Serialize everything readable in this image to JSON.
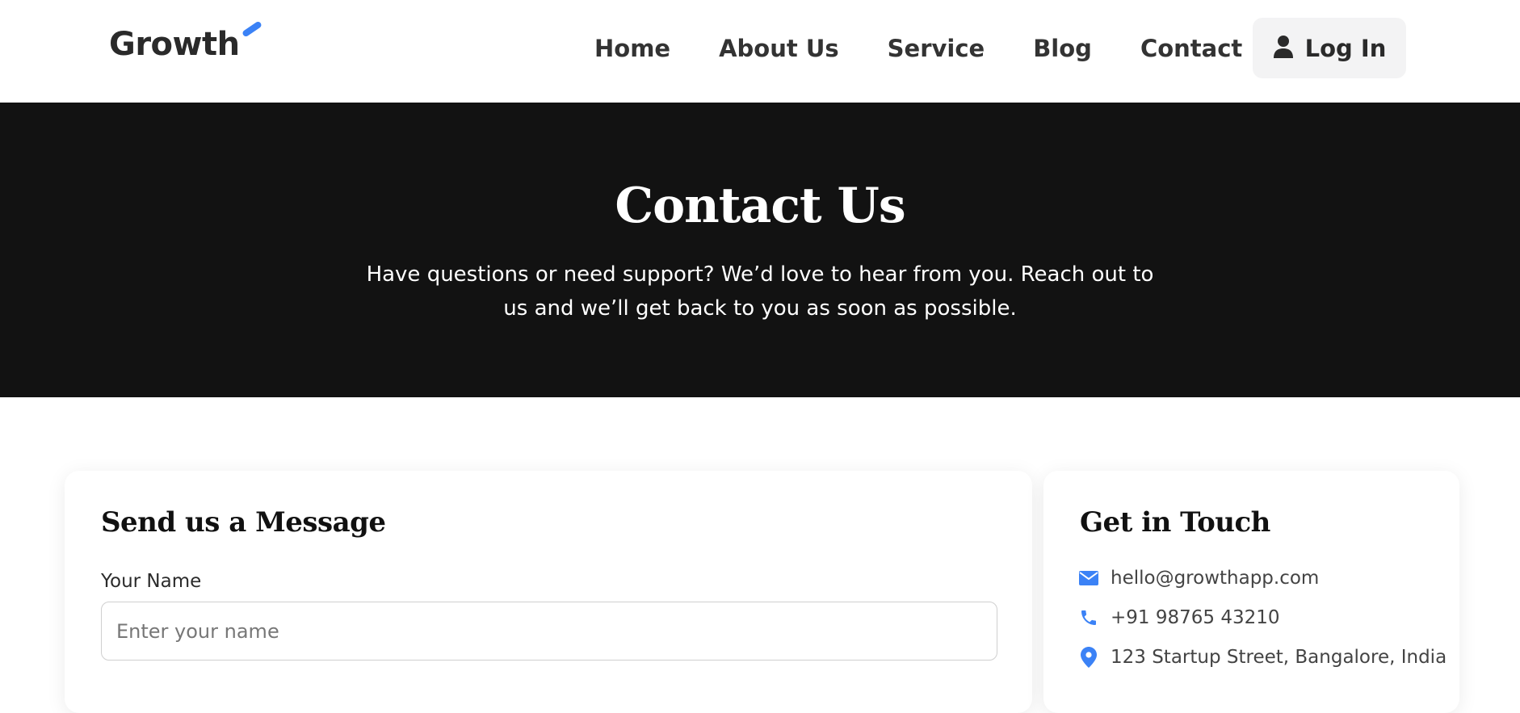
{
  "header": {
    "logo_text": "Growth",
    "nav": [
      "Home",
      "About Us",
      "Service",
      "Blog",
      "Contact"
    ],
    "login_label": "Log In",
    "login_icon": "user-icon"
  },
  "hero": {
    "title": "Contact Us",
    "subtitle": "Have questions or need support? We’d love to hear from you. Reach out to us and we’ll get back to you as soon as possible."
  },
  "form": {
    "title": "Send us a Message",
    "name_label": "Your Name",
    "name_placeholder": "Enter your name",
    "name_value": ""
  },
  "info": {
    "title": "Get in Touch",
    "email": "hello@growthapp.com",
    "phone": "+91 98765 43210",
    "address": "123 Startup Street, Bangalore, India",
    "icons": [
      "envelope-icon",
      "phone-icon",
      "map-pin-icon"
    ]
  },
  "colors": {
    "accent": "#3b82f6",
    "hero_bg": "#121212",
    "login_bg": "#f3f3f4"
  }
}
